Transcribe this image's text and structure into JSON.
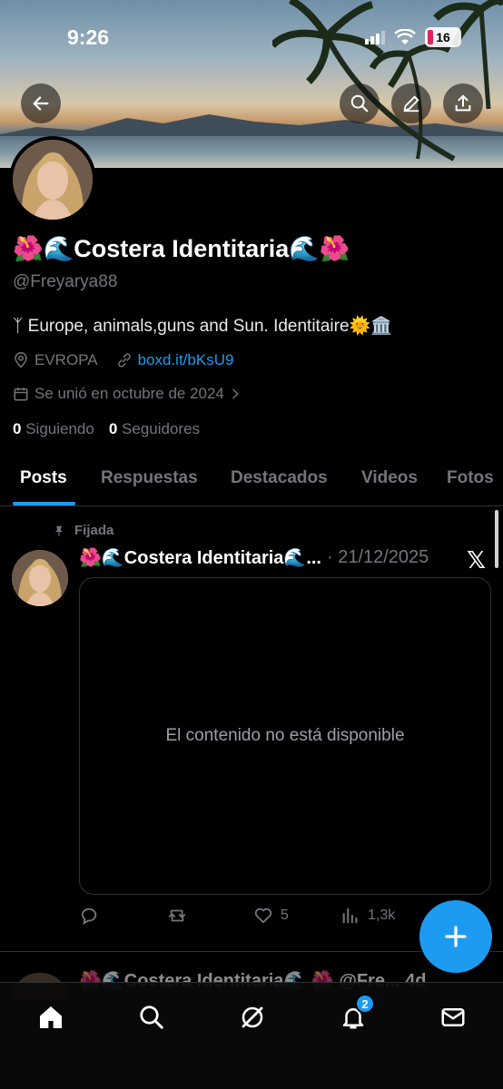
{
  "status_bar": {
    "time": "9:26",
    "battery": "16"
  },
  "profile": {
    "name": "🌺🌊Costera Identitaria🌊🌺",
    "handle": "@Freyarya88",
    "bio": "ᛉ Europe, animals,guns and Sun. Identitaire🌞🏛️",
    "location": "EVROPA",
    "link": "boxd.it/bKsU9",
    "joined": "Se unió en octubre de 2024",
    "following_count": "0",
    "following_label": "Siguiendo",
    "followers_count": "0",
    "followers_label": "Seguidores"
  },
  "tabs": [
    {
      "label": "Posts",
      "active": true
    },
    {
      "label": "Respuestas"
    },
    {
      "label": "Destacados"
    },
    {
      "label": "Videos"
    },
    {
      "label": "Fotos"
    }
  ],
  "pinned_post": {
    "pinned_label": "Fijada",
    "author": "🌺🌊Costera Identitaria🌊...",
    "date": "· 21/12/2025",
    "source_icon": "x-logo",
    "content": "El contenido no está disponible",
    "likes": "5",
    "views": "1,3k"
  },
  "next_post": {
    "header": "🌺🌊Costera Identitaria🌊 🌺 @Fre... 4d"
  },
  "nav": {
    "notifications_badge": "2"
  },
  "colors": {
    "accent": "#1d9bf0",
    "background": "#000000",
    "muted": "#71767b"
  }
}
